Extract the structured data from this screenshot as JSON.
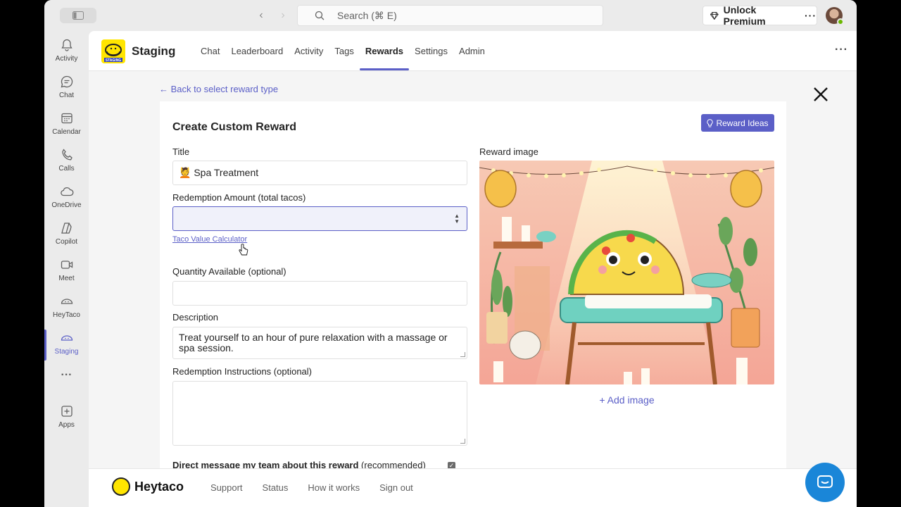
{
  "titlebar": {
    "search_placeholder": "Search (⌘ E)",
    "premium_label": "Unlock Premium",
    "premium_more": "···"
  },
  "rail": {
    "items": [
      {
        "label": "Activity",
        "icon": "bell-icon"
      },
      {
        "label": "Chat",
        "icon": "chat-icon"
      },
      {
        "label": "Calendar",
        "icon": "calendar-icon"
      },
      {
        "label": "Calls",
        "icon": "phone-icon"
      },
      {
        "label": "OneDrive",
        "icon": "cloud-icon"
      },
      {
        "label": "Copilot",
        "icon": "copilot-icon"
      },
      {
        "label": "Meet",
        "icon": "video-icon"
      },
      {
        "label": "HeyTaco",
        "icon": "taco-icon"
      },
      {
        "label": "Staging",
        "icon": "taco-icon"
      },
      {
        "label": "···",
        "icon": "more-icon"
      },
      {
        "label": "Apps",
        "icon": "apps-icon"
      }
    ],
    "active_index": 8
  },
  "app": {
    "title": "Staging",
    "logo_text": "STAGING",
    "tabs": [
      {
        "label": "Chat"
      },
      {
        "label": "Leaderboard"
      },
      {
        "label": "Activity"
      },
      {
        "label": "Tags"
      },
      {
        "label": "Rewards"
      },
      {
        "label": "Settings"
      },
      {
        "label": "Admin"
      }
    ],
    "active_tab": "Rewards",
    "more": "···"
  },
  "page": {
    "back_link": "← Back to select reward type",
    "card_title": "Create Custom Reward",
    "ideas_button": "Reward Ideas",
    "title_label": "Title",
    "title_value": "💆 Spa Treatment",
    "amount_label": "Redemption Amount (total tacos)",
    "amount_value": "",
    "calculator_link": "Taco Value Calculator",
    "quantity_label": "Quantity Available (optional)",
    "quantity_value": "",
    "description_label": "Description",
    "description_value": "Treat yourself to an hour of pure relaxation with a massage or spa session.",
    "instructions_label": "Redemption Instructions (optional)",
    "instructions_value": "",
    "dm_label_bold": "Direct message my team about this reward",
    "dm_label_rest": " (recommended)",
    "dm_checked": true,
    "image_label": "Reward image",
    "add_image": "+ Add image"
  },
  "footer": {
    "brand": "Heytaco",
    "links": [
      "Support",
      "Status",
      "How it works",
      "Sign out"
    ]
  },
  "colors": {
    "accent": "#5b5fc7",
    "taco_yellow": "#ffe500",
    "help_blue": "#1a86d8"
  }
}
